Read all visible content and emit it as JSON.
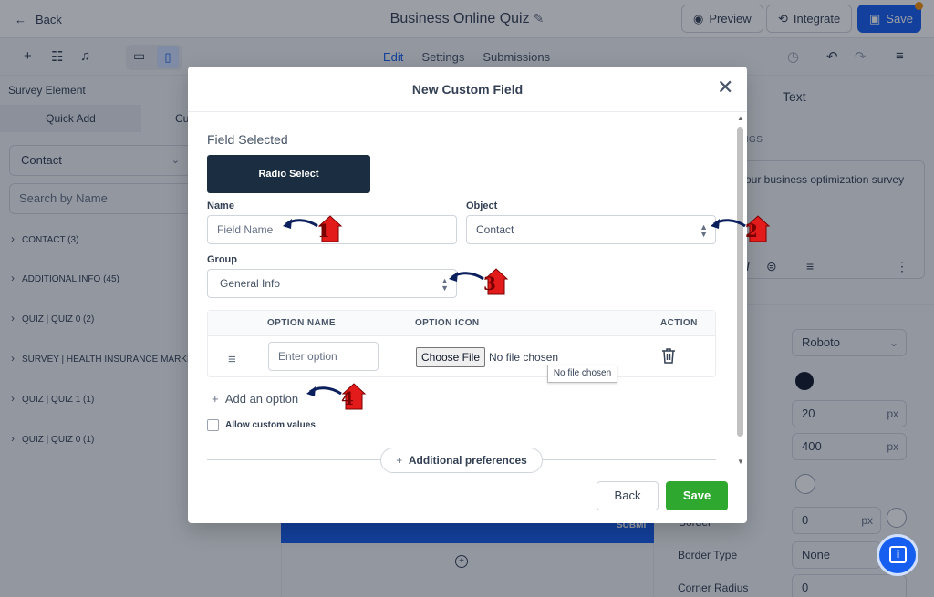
{
  "topbar": {
    "back_label": "Back",
    "title": "Business Online Quiz",
    "preview_label": "Preview",
    "integrate_label": "Integrate",
    "save_label": "Save"
  },
  "subbar": {
    "tabs": [
      {
        "label": "Edit",
        "active": true
      },
      {
        "label": "Settings",
        "active": false
      },
      {
        "label": "Submissions",
        "active": false
      }
    ]
  },
  "left_panel": {
    "title": "Survey Element",
    "tab_quick_add": "Quick Add",
    "tab_custom": "Cu",
    "contact_select": "Contact",
    "search_placeholder": "Search by Name",
    "categories": [
      "CONTACT (3)",
      "ADDITIONAL INFO (45)",
      "QUIZ | QUIZ 0 (2)",
      "SURVEY | HEALTH INSURANCE MARKE",
      "QUIZ | QUIZ 1 (1)",
      "QUIZ | QUIZ 0 (1)"
    ]
  },
  "right_panel": {
    "heading": "Text",
    "settings_label": "INGS",
    "content_text": "our business optimization survey",
    "font_value": "Roboto",
    "size_value": "20",
    "weight_value": "400",
    "border_value": "0",
    "border_type_label": "Border Type",
    "border_type_value": "None",
    "corner_radius_label": "Corner Radius",
    "corner_radius_value": "0",
    "unit_px": "px",
    "border_label_partial": "Border"
  },
  "canvas": {
    "submit_text": "SUBMI"
  },
  "modal": {
    "title": "New Custom Field",
    "field_selected_label": "Field Selected",
    "field_type": "Radio Select",
    "name_label": "Name",
    "name_placeholder": "Field Name",
    "object_label": "Object",
    "object_value": "Contact",
    "group_label": "Group",
    "group_value": "General Info",
    "table": {
      "headers": [
        "OPTION NAME",
        "OPTION ICON",
        "ACTION"
      ],
      "option_placeholder": "Enter option",
      "choose_file": "Choose File",
      "no_file": "No file chosen"
    },
    "tooltip": "No file chosen",
    "add_option": "Add an option",
    "allow_custom": "Allow custom values",
    "additional_prefs": "Additional preferences",
    "back_label": "Back",
    "save_label": "Save"
  },
  "annotations": [
    "1",
    "2",
    "3",
    "4"
  ],
  "colors": {
    "primary": "#155eef",
    "save_green": "#2ea82f",
    "chip_dark": "#1b2d40",
    "annotation_red": "#e31b1b",
    "arrow_navy": "#0b1f5c"
  }
}
